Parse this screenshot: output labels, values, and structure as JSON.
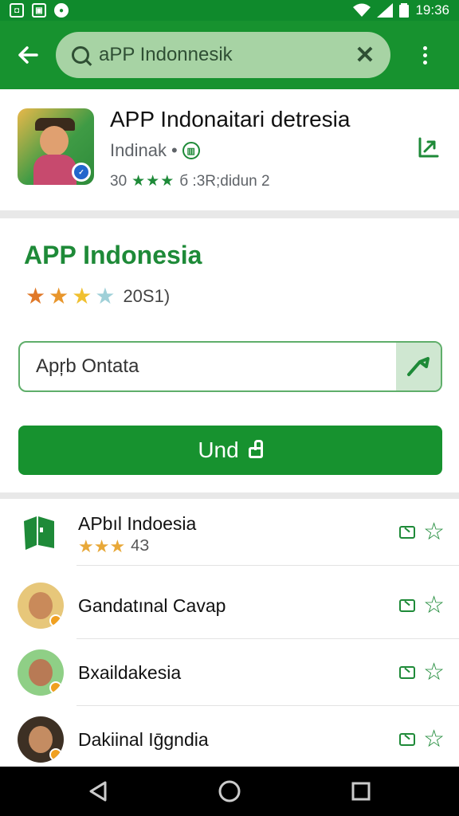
{
  "status_bar": {
    "time": "19:36"
  },
  "toolbar": {
    "search_value": "aPP Indonnesik"
  },
  "app": {
    "title": "APP Indonaitari detresia",
    "developer": "Indinak",
    "meta_left": "30",
    "meta_stars": "★★★",
    "meta_right": "б :3R;dіdun 2"
  },
  "details": {
    "title": "APP Indonesia",
    "rating_count": "20Ѕ1)",
    "input_value": "Apŗb Ontata",
    "button_label": "Und"
  },
  "list": [
    {
      "label": "APbıl Indoesia",
      "stars": "★★★",
      "rating_text": "4З"
    },
    {
      "label": "Gandatınal Cavap"
    },
    {
      "label": "Bxaildakesia"
    },
    {
      "label": "Dakiinal Iḡgndia"
    }
  ],
  "colors": {
    "brand": "#17922f",
    "status": "#0f8a2c",
    "accent": "#1e8a38"
  }
}
